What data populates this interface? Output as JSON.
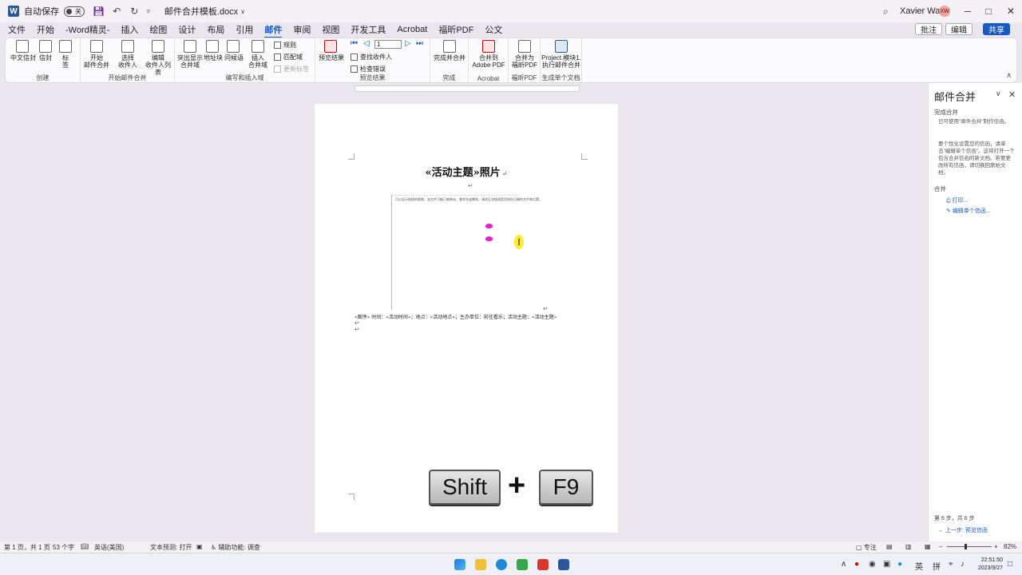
{
  "titlebar": {
    "autosave_label": "自动保存",
    "autosave_state": "关",
    "filename": "邮件合并模板.docx",
    "user": "Xavier Wang",
    "user_initials": "XW"
  },
  "tabs": [
    "文件",
    "开始",
    "-Word精灵-",
    "插入",
    "绘图",
    "设计",
    "布局",
    "引用",
    "邮件",
    "审阅",
    "视图",
    "开发工具",
    "Acrobat",
    "福昕PDF",
    "公文"
  ],
  "active_tab": "邮件",
  "tab_actions": {
    "comments": "批注",
    "edit": "编辑",
    "share": "共享"
  },
  "ribbon": {
    "create": {
      "label": "创建",
      "chinese_envelope": "中文信封",
      "envelope": "信封",
      "labels": "标\n签"
    },
    "start": {
      "label": "开始邮件合并",
      "start_merge": "开始\n邮件合并",
      "select_recipients": "选择\n收件人",
      "edit_list": "编辑\n收件人列表"
    },
    "write": {
      "label": "编写和插入域",
      "highlight": "突出显示\n合并域",
      "address_block": "地址块",
      "greeting": "问候语",
      "insert_field": "插入\n合并域",
      "rules": "规则",
      "match_fields": "匹配域",
      "update_labels": "更新标签"
    },
    "preview": {
      "label": "预览结果",
      "preview_results": "预览结果",
      "record": "1",
      "find_recipient": "查找收件人",
      "check_errors": "检查错误"
    },
    "finish": {
      "label": "完成",
      "finish_merge": "完成并合并"
    },
    "acrobat": {
      "label": "Acrobat",
      "merge_to_pdf": "合并到\nAdobe PDF"
    },
    "foxit": {
      "label": "福昕PDF",
      "merge_foxit": "合并为\n福昕PDF"
    },
    "generate": {
      "label": "生成单个文档",
      "project": "Project.模块1.\n执行邮件合并"
    }
  },
  "document": {
    "title": "«活动主题»照片",
    "frame_text": "可以显示链接的图像。该文件可能已被移动、重命名或删除。请验证该链接是否指向正确的文件和位置。",
    "field_line": "«图序»  时间：«活动时间»；地点：«活动地点»；主办单位：前往看乐；活动主题：«活动主题»"
  },
  "keys": {
    "key1": "Shift",
    "plus": "+",
    "key2": "F9"
  },
  "pane": {
    "title": "邮件合并",
    "section": "完成合并",
    "text1": "已可使用\"邮件合并\"制作信函。",
    "text2": "要个性化设置您的信函，请单击\"编辑单个信函\"。这将打开一个包含合并信函的新文档。若要更改所有信函，请切换回原始文档。",
    "merge_heading": "合并",
    "print_link": "打印...",
    "edit_link": "编辑单个信函...",
    "step": "第 6 步，共 6 步",
    "prev_link": "← 上一步: 预览信函"
  },
  "status": {
    "page": "第 1 页，共 1 页",
    "words": "53 个字",
    "language": "英语(美国)",
    "predict": "文本预测: 打开",
    "accessibility": "辅助功能: 调查",
    "focus": "专注",
    "zoom": "82%"
  },
  "taskbar": {
    "lang": "英",
    "ime": "拼",
    "time": "22:51:50",
    "date": "2023/9/27"
  }
}
